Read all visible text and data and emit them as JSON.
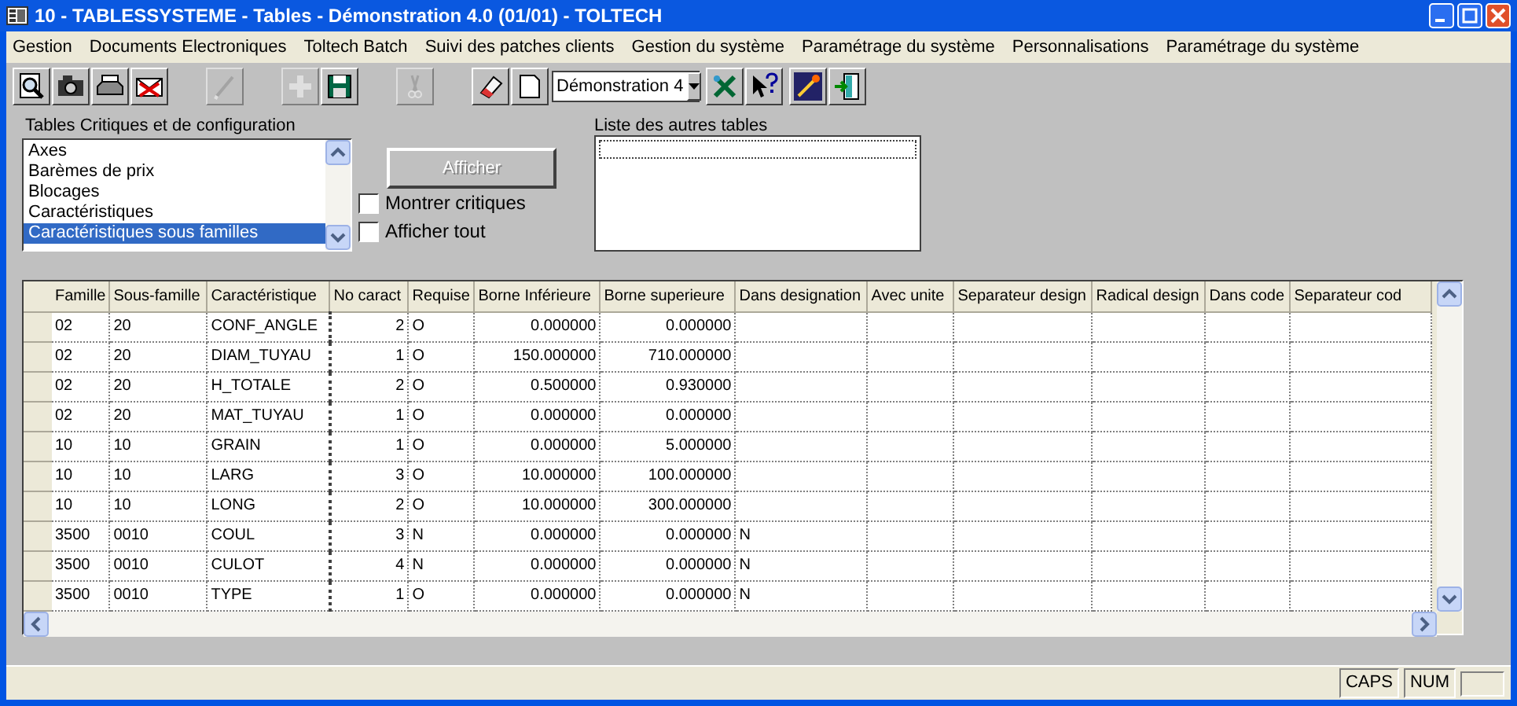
{
  "window": {
    "title": "10 - TABLESSYSTEME - Tables - Démonstration 4.0 (01/01) - TOLTECH"
  },
  "menu": [
    "Gestion",
    "Documents Electroniques",
    "Toltech Batch",
    "Suivi des patches clients",
    "Gestion du système",
    "Paramétrage du système",
    "Personnalisations",
    "Paramétrage du système"
  ],
  "toolbar": {
    "groups": [
      [
        {
          "kind": "preview",
          "disabled": false
        },
        {
          "kind": "camera",
          "disabled": false
        },
        {
          "kind": "printer",
          "disabled": false
        },
        {
          "kind": "mail",
          "disabled": false
        }
      ],
      [
        {
          "kind": "pen",
          "disabled": true
        }
      ],
      [
        {
          "kind": "plus",
          "disabled": true
        },
        {
          "kind": "save",
          "disabled": false
        }
      ],
      [
        {
          "kind": "scissors",
          "disabled": true
        }
      ],
      [
        {
          "kind": "eraser",
          "disabled": false
        },
        {
          "kind": "page",
          "disabled": false
        }
      ]
    ],
    "dropdown": {
      "value": "Démonstration 4"
    },
    "groups_after": [
      [
        {
          "kind": "tools",
          "disabled": false
        },
        {
          "kind": "help",
          "disabled": false
        }
      ],
      [
        {
          "kind": "wand",
          "disabled": false
        },
        {
          "kind": "exit",
          "disabled": false
        }
      ]
    ]
  },
  "critical_tables": {
    "label": "Tables Critiques et de configuration",
    "items": [
      {
        "text": "Axes",
        "selected": false
      },
      {
        "text": "Barèmes de prix",
        "selected": false
      },
      {
        "text": "Blocages",
        "selected": false
      },
      {
        "text": "Caractéristiques",
        "selected": false
      },
      {
        "text": "Caractéristiques sous familles",
        "selected": true
      }
    ]
  },
  "show_button": {
    "label": "Afficher",
    "disabled": true
  },
  "checkboxes": [
    {
      "label": "Montrer critiques",
      "checked": false
    },
    {
      "label": "Afficher tout",
      "checked": false
    }
  ],
  "other_tables": {
    "label": "Liste des autres tables"
  },
  "table": {
    "columns": [
      "Famille",
      "Sous-famille",
      "Caractéristique",
      "No caract",
      "Requise",
      "Borne Inférieure",
      "Borne superieure",
      "Dans designation",
      "Avec unite",
      "Separateur design",
      "Radical design",
      "Dans code",
      "Separateur cod"
    ],
    "rows": [
      [
        "02",
        "20",
        "CONF_ANGLE",
        "2",
        "O",
        "0.000000",
        "0.000000"
      ],
      [
        "02",
        "20",
        "DIAM_TUYAU",
        "1",
        "O",
        "150.000000",
        "710.000000"
      ],
      [
        "02",
        "20",
        "H_TOTALE",
        "2",
        "O",
        "0.500000",
        "0.930000"
      ],
      [
        "02",
        "20",
        "MAT_TUYAU",
        "1",
        "O",
        "0.000000",
        "0.000000"
      ],
      [
        "10",
        "10",
        "GRAIN",
        "1",
        "O",
        "0.000000",
        "5.000000"
      ],
      [
        "10",
        "10",
        "LARG",
        "3",
        "O",
        "10.000000",
        "100.000000"
      ],
      [
        "10",
        "10",
        "LONG",
        "2",
        "O",
        "10.000000",
        "300.000000"
      ],
      [
        "3500",
        "0010",
        "COUL",
        "3",
        "N",
        "0.000000",
        "0.000000",
        "N"
      ],
      [
        "3500",
        "0010",
        "CULOT",
        "4",
        "N",
        "0.000000",
        "0.000000",
        "N"
      ],
      [
        "3500",
        "0010",
        "TYPE",
        "1",
        "O",
        "0.000000",
        "0.000000",
        "N"
      ]
    ]
  },
  "status_bar": [
    "CAPS",
    "NUM"
  ]
}
